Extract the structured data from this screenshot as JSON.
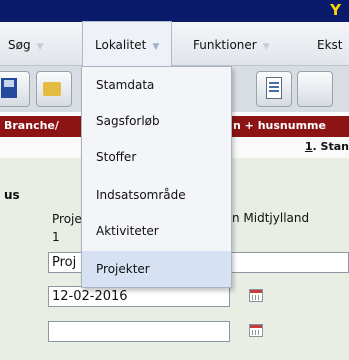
{
  "title_bar": {
    "trailing_char": "Y"
  },
  "menu": [
    {
      "label": "Søg"
    },
    {
      "label": "Lokalitet",
      "open": true
    },
    {
      "label": "Funktioner"
    },
    {
      "label": "Ekst"
    }
  ],
  "toolbar": {
    "buttons": [
      {
        "icon": "save-icon"
      },
      {
        "icon": "folder-icon"
      },
      {
        "icon": "document-icon"
      },
      {
        "icon": "toolbar-icon"
      }
    ]
  },
  "red_band": {
    "left_text": "Branche/",
    "right_text": "n + husnumme"
  },
  "tab_strip": {
    "hotkey": "1",
    "label": ". Stan"
  },
  "content": {
    "left_label": "us",
    "proj_label": "Proje",
    "proj_number": "1",
    "region": "n Midtjylland",
    "proj_input_value": "Proj",
    "date_value": "12-02-2016",
    "empty_date_value": ""
  },
  "dropdown": {
    "items": [
      {
        "label": "Stamdata"
      },
      {
        "label": "Sagsforløb"
      },
      {
        "label": "Stoffer"
      },
      {
        "label": "Indsatsområde"
      },
      {
        "label": "Aktiviteter"
      },
      {
        "label": "Projekter",
        "highlighted": true
      }
    ]
  },
  "colors": {
    "title_bar": "#0b1b6b",
    "title_text": "#ffd400",
    "red_band": "#8c1414",
    "content_bg": "#e8eee4",
    "dropdown_highlight": "#d6e1f3"
  }
}
